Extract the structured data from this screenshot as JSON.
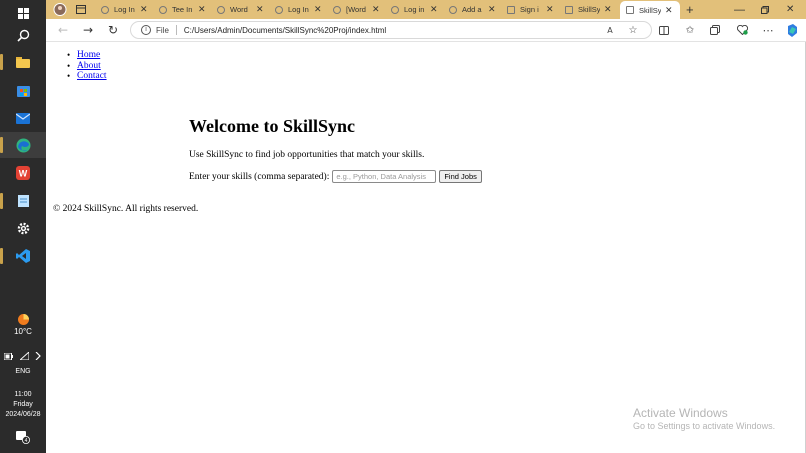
{
  "taskbar": {
    "weather_temp": "10°C",
    "language": "ENG",
    "time": "11:00",
    "day": "Friday",
    "date": "2024/06/28",
    "notification_count": "4"
  },
  "browser": {
    "tabs": [
      {
        "title": "Log In",
        "icon": "wordpress-icon"
      },
      {
        "title": "Tee In",
        "icon": "wordpress-icon"
      },
      {
        "title": "Word",
        "icon": "wordpress-icon"
      },
      {
        "title": "Log In",
        "icon": "wordpress-icon"
      },
      {
        "title": "[Word",
        "icon": "wordpress-icon"
      },
      {
        "title": "Log in",
        "icon": "wordpress-icon"
      },
      {
        "title": "Add a",
        "icon": "wordpress-icon"
      },
      {
        "title": "Sign i",
        "icon": "page-icon"
      },
      {
        "title": "SkillSy",
        "icon": "page-icon"
      },
      {
        "title": "SkillSy",
        "icon": "page-icon",
        "active": true
      }
    ],
    "address": {
      "scheme_label": "File",
      "url": "C:/Users/Admin/Documents/SkillSync%20Proj/index.html"
    }
  },
  "page": {
    "nav": [
      "Home",
      "About",
      "Contact"
    ],
    "heading": "Welcome to SkillSync",
    "intro": "Use SkillSync to find job opportunities that match your skills.",
    "skills_label": "Enter your skills (comma separated):",
    "skills_placeholder": "e.g., Python, Data Analysis",
    "find_button": "Find Jobs",
    "footer": "© 2024 SkillSync. All rights reserved."
  },
  "watermark": {
    "line1": "Activate Windows",
    "line2": "Go to Settings to activate Windows."
  },
  "colors": {
    "tabstrip": "#e2c07a",
    "taskbar": "#2b2b2b",
    "link": "#0000ee"
  }
}
